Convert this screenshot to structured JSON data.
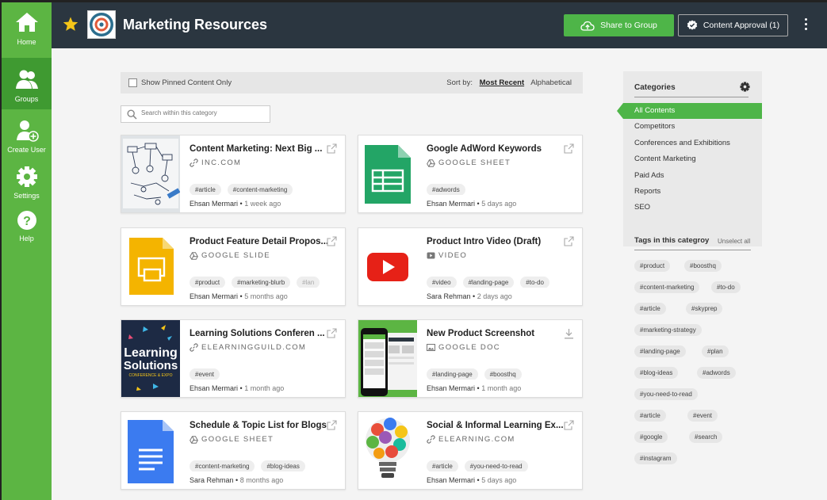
{
  "sidebar": {
    "items": [
      {
        "label": "Home",
        "icon": "home-icon"
      },
      {
        "label": "Groups",
        "icon": "groups-icon"
      },
      {
        "label": "Create User",
        "icon": "add-user-icon"
      },
      {
        "label": "Settings",
        "icon": "gear-icon"
      },
      {
        "label": "Help",
        "icon": "help-icon"
      }
    ]
  },
  "header": {
    "title": "Marketing Resources",
    "share_label": "Share to Group",
    "approval_label": "Content Approval (1)"
  },
  "filter": {
    "pinned_label": "Show Pinned Content Only",
    "sort_label": "Sort by:",
    "sort_recent": "Most Recent",
    "sort_alpha": "Alphabetical"
  },
  "search": {
    "placeholder": "Search within this category"
  },
  "cards": [
    {
      "title": "Content Marketing: Next Big ...",
      "source": "INC.COM",
      "tags": [
        "#article",
        "#content-marketing"
      ],
      "author": "Ehsan Mermari",
      "time": "1 week ago"
    },
    {
      "title": "Google AdWord Keywords",
      "source": "GOOGLE SHEET",
      "tags": [
        "#adwords"
      ],
      "author": "Ehsan Mermari",
      "time": "5 days ago"
    },
    {
      "title": "Product Feature Detail Propos...",
      "source": "GOOGLE SLIDE",
      "tags": [
        "#product",
        "#marketing-blurb",
        "#lan"
      ],
      "author": "Ehsan Mermari",
      "time": "5 months ago"
    },
    {
      "title": "Product Intro Video (Draft)",
      "source": "VIDEO",
      "tags": [
        "#video",
        "#landing-page",
        "#to-do"
      ],
      "author": "Sara Rehman",
      "time": "2 days ago"
    },
    {
      "title": "Learning Solutions Conferen ...",
      "source": "ELEARNINGGUILD.COM",
      "tags": [
        "#event"
      ],
      "author": "Ehsan Mermari",
      "time": "1 month ago"
    },
    {
      "title": "New Product Screenshot",
      "source": "GOOGLE DOC",
      "tags": [
        "#landing-page",
        "#boosthq"
      ],
      "author": "Ehsan Mermari",
      "time": "1 month ago"
    },
    {
      "title": "Schedule & Topic List for Blogs",
      "source": "GOOGLE SHEET",
      "tags": [
        "#content-marketing",
        "#blog-ideas"
      ],
      "author": "Sara Rehman",
      "time": "8 months ago"
    },
    {
      "title": "Social & Informal Learning Ex...",
      "source": "ELEARNING.COM",
      "tags": [
        "#article",
        "#you-need-to-read"
      ],
      "author": "Ehsan Mermari",
      "time": "5 days ago"
    }
  ],
  "thumb_text": {
    "learning": "Learning",
    "solutions": "Solutions",
    "sub": "CONFERENCE & EXPO"
  },
  "categories": {
    "title": "Categories",
    "items": [
      "All Contents",
      "Competitors",
      "Conferences and Exhibitions",
      "Content Marketing",
      "Paid Ads",
      "Reports",
      "SEO"
    ]
  },
  "tag_panel": {
    "title": "Tags in this categroy",
    "unselect": "Unselect all",
    "tags": [
      "#product",
      "#boosthq",
      "#content-marketing",
      "#to-do",
      "#article",
      "#skyprep",
      "#marketing-strategy",
      "#landing-page",
      "#plan",
      "#blog-ideas",
      "#adwords",
      "#you-need-to-read",
      "#article",
      "#event",
      "#google",
      "#search",
      "#instagram"
    ]
  },
  "colors": {
    "accent": "#4eb548",
    "sidebar": "#5cb543",
    "header": "#2b3640"
  }
}
